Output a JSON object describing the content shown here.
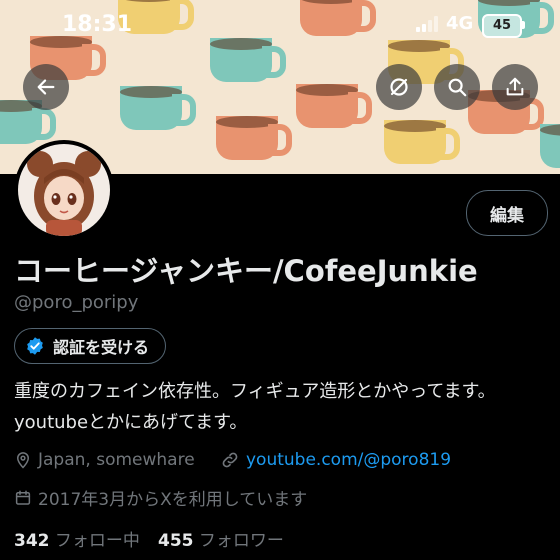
{
  "status_bar": {
    "time": "18:31",
    "network": "4G",
    "battery": "45"
  },
  "header": {
    "back_icon": "arrow-left-icon",
    "mute_icon": "eye-slash-icon",
    "search_icon": "search-icon",
    "share_icon": "share-icon"
  },
  "profile": {
    "edit_label": "編集",
    "display_name": "コーヒージャンキー/CofeeJunkie",
    "handle": "@poro_poripy",
    "verify_label": "認証を受ける",
    "bio": "重度のカフェイン依存性。フィギュア造形とかやってます。youtubeとかにあげてます。",
    "location": "Japan, somewhare",
    "link": "youtube.com/@poro819",
    "joined": "2017年3月からXを利用しています",
    "following_count": "342",
    "following_label": "フォロー中",
    "followers_count": "455",
    "followers_label": "フォロワー"
  },
  "colors": {
    "accent": "#1d9bf0",
    "muted": "#71767b",
    "text": "#e7e9ea",
    "background": "#000000"
  }
}
